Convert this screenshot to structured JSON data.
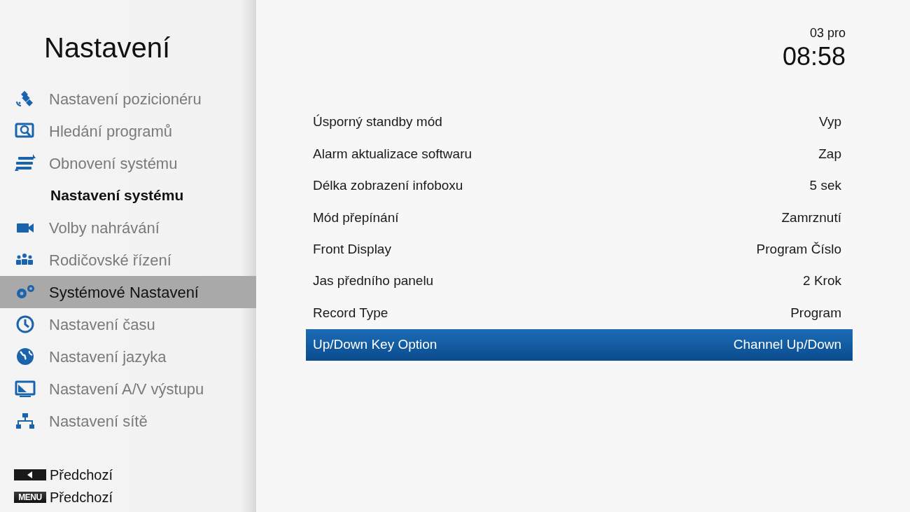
{
  "sidebar": {
    "title": "Nastavení",
    "items": [
      {
        "kind": "item",
        "label": "Nastavení pozicionéru",
        "selected": false
      },
      {
        "kind": "item",
        "label": "Hledání programů",
        "selected": false
      },
      {
        "kind": "item",
        "label": "Obnovení systému",
        "selected": false
      },
      {
        "kind": "header",
        "label": "Nastavení systému"
      },
      {
        "kind": "item",
        "label": "Volby nahrávání",
        "selected": false
      },
      {
        "kind": "item",
        "label": "Rodičovské řízení",
        "selected": false
      },
      {
        "kind": "item",
        "label": "Systémové Nastavení",
        "selected": true
      },
      {
        "kind": "item",
        "label": "Nastavení času",
        "selected": false
      },
      {
        "kind": "item",
        "label": "Nastavení jazyka",
        "selected": false
      },
      {
        "kind": "item",
        "label": "Nastavení A/V výstupu",
        "selected": false
      },
      {
        "kind": "item",
        "label": "Nastavení sítě",
        "selected": false
      }
    ],
    "hints": [
      {
        "kind": "arrow",
        "label": "Předchozí"
      },
      {
        "kind": "text",
        "key": "MENU",
        "label": "Předchozí"
      }
    ]
  },
  "clock": {
    "date": "03 pro",
    "time": "08:58"
  },
  "settings": [
    {
      "label": "Úsporný standby mód",
      "value": "Vyp",
      "selected": false
    },
    {
      "label": "Alarm aktualizace softwaru",
      "value": "Zap",
      "selected": false
    },
    {
      "label": "Délka zobrazení infoboxu",
      "value": "5 sek",
      "selected": false
    },
    {
      "label": "Mód přepínání",
      "value": "Zamrznutí",
      "selected": false
    },
    {
      "label": "Front Display",
      "value": "Program Číslo",
      "selected": false
    },
    {
      "label": "Jas předního panelu",
      "value": "2 Krok",
      "selected": false
    },
    {
      "label": "Record Type",
      "value": "Program",
      "selected": false
    },
    {
      "label": "Up/Down Key Option",
      "value": "Channel Up/Down",
      "selected": true
    }
  ]
}
